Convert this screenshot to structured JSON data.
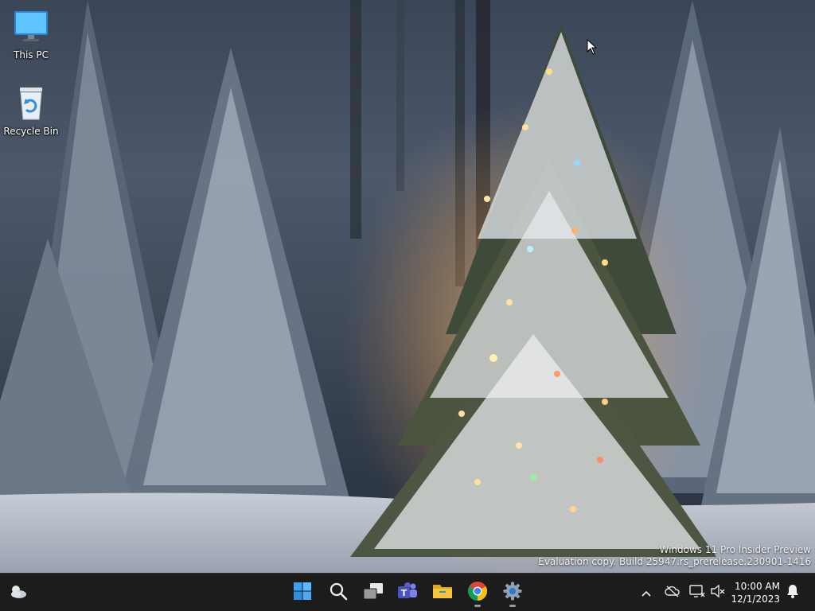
{
  "desktop": {
    "icons": [
      {
        "label": "This PC",
        "icon": "monitor-icon"
      },
      {
        "label": "Recycle Bin",
        "icon": "recycle-bin-icon"
      }
    ]
  },
  "watermark": {
    "line1": "Windows 11 Pro Insider Preview",
    "line2": "Evaluation copy. Build 25947.rs_prerelease.230901-1416"
  },
  "taskbar": {
    "widgets_icon": "weather-widget-icon",
    "apps": [
      {
        "name": "Start",
        "icon": "windows-start-icon",
        "running": false
      },
      {
        "name": "Search",
        "icon": "search-icon",
        "running": false
      },
      {
        "name": "Task View",
        "icon": "task-view-icon",
        "running": false
      },
      {
        "name": "Teams",
        "icon": "teams-icon",
        "running": false
      },
      {
        "name": "File Explorer",
        "icon": "file-explorer-icon",
        "running": false
      },
      {
        "name": "Google Chrome",
        "icon": "chrome-icon",
        "running": true
      },
      {
        "name": "Settings",
        "icon": "settings-gear-icon",
        "running": true
      }
    ],
    "tray": [
      "chevron-up-icon",
      "onedrive-offline-icon",
      "network-icon",
      "volume-muted-icon",
      "notification-bell-icon"
    ],
    "clock": {
      "time": "10:00 AM",
      "date": "12/1/2023"
    }
  },
  "colors": {
    "taskbar_bg": "#1c1c1c",
    "start_blue": "#3aa0f0",
    "chrome_red": "#db4437",
    "chrome_yellow": "#f4c20d",
    "chrome_green": "#0f9d58",
    "chrome_blue": "#4285f4",
    "folder_yellow": "#f8c43a"
  }
}
